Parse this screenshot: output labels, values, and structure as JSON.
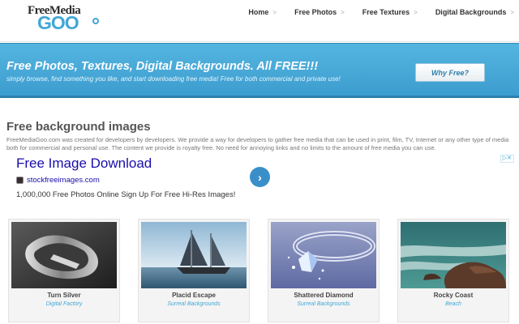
{
  "logo": {
    "top": "FreeMedia",
    "bottom": "GOO"
  },
  "nav": [
    {
      "label": "Home"
    },
    {
      "label": "Free Photos"
    },
    {
      "label": "Free Textures"
    },
    {
      "label": "Digital Backgrounds"
    }
  ],
  "banner": {
    "title": "Free Photos, Textures, Digital Backgrounds. All FREE!!!",
    "subtitle": "simply browse, find something you like, and start downloading free media! Free for both commercial and private use!",
    "button": "Why Free?"
  },
  "content": {
    "title": "Free background images",
    "description": "FreeMediaGoo.com was created for developers by developers. We provide a way for developers to gather free media that can be used in print, film, TV, Internet or any other type of media both for commercial and personal use. The content we provide is royalty free. No need for annoying links and no limits to the amount of free media you can use."
  },
  "ad": {
    "title": "Free Image Download",
    "site": "stockfreeimages.com",
    "text": "1,000,000 Free Photos Online Sign Up For Free Hi-Res Images!"
  },
  "gallery": [
    {
      "title": "Turn Silver",
      "category": "Digital Factory"
    },
    {
      "title": "Placid Escape",
      "category": "Surreal Backgrounds"
    },
    {
      "title": "Shattered Diamond",
      "category": "Surreal Backgrounds"
    },
    {
      "title": "Rocky Coast",
      "category": "Beach"
    }
  ],
  "colors": {
    "accent": "#3fa7d6",
    "banner": "#4aa9d9"
  }
}
